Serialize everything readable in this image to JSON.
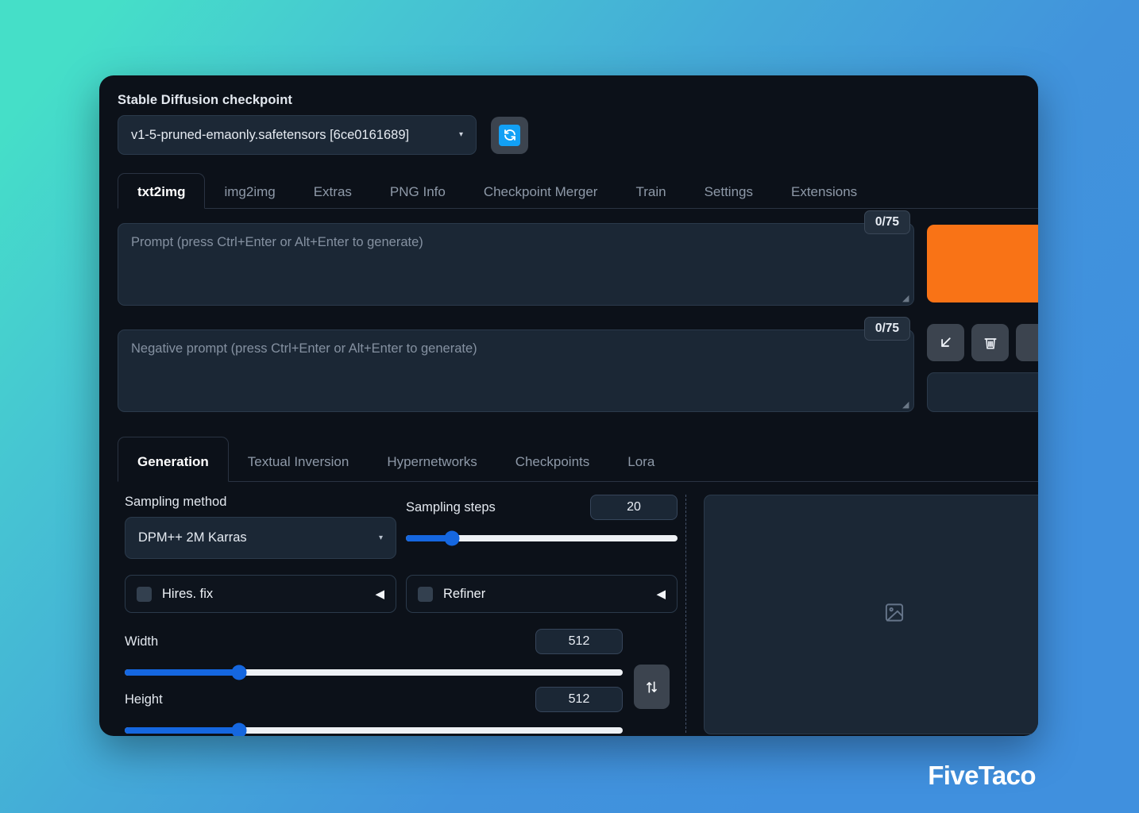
{
  "background": {
    "gradient_from": "#45dfc8",
    "gradient_to": "#4090de"
  },
  "watermark": {
    "text": "FiveTaco"
  },
  "checkpoint": {
    "label": "Stable Diffusion checkpoint",
    "value": "v1-5-pruned-emaonly.safetensors [6ce0161689]",
    "caret": "▾",
    "refresh_icon": "↻"
  },
  "main_tabs": [
    {
      "label": "txt2img",
      "active": true
    },
    {
      "label": "img2img",
      "active": false
    },
    {
      "label": "Extras",
      "active": false
    },
    {
      "label": "PNG Info",
      "active": false
    },
    {
      "label": "Checkpoint Merger",
      "active": false
    },
    {
      "label": "Train",
      "active": false
    },
    {
      "label": "Settings",
      "active": false
    },
    {
      "label": "Extensions",
      "active": false
    }
  ],
  "prompt": {
    "placeholder": "Prompt (press Ctrl+Enter or Alt+Enter to generate)",
    "value": "",
    "token_count": "0/75"
  },
  "negative_prompt": {
    "placeholder": "Negative prompt (press Ctrl+Enter or Alt+Enter to generate)",
    "value": "",
    "token_count": "0/75"
  },
  "actions": {
    "generate_label": "",
    "generate_color": "#f97316",
    "icons": [
      {
        "name": "arrow-down-left-icon",
        "glyph": "↙"
      },
      {
        "name": "trash-icon",
        "glyph": "🗑"
      }
    ]
  },
  "sub_tabs": [
    {
      "label": "Generation",
      "active": true
    },
    {
      "label": "Textual Inversion",
      "active": false
    },
    {
      "label": "Hypernetworks",
      "active": false
    },
    {
      "label": "Checkpoints",
      "active": false
    },
    {
      "label": "Lora",
      "active": false
    }
  ],
  "generation": {
    "sampling_method": {
      "label": "Sampling method",
      "value": "DPM++ 2M Karras",
      "caret": "▾"
    },
    "sampling_steps": {
      "label": "Sampling steps",
      "value": "20",
      "fill_percent": 17
    },
    "hires_fix": {
      "label": "Hires. fix",
      "checked": false,
      "arrow": "◀"
    },
    "refiner": {
      "label": "Refiner",
      "checked": false,
      "arrow": "◀"
    },
    "width": {
      "label": "Width",
      "value": "512",
      "fill_percent": 23
    },
    "height": {
      "label": "Height",
      "value": "512",
      "fill_percent": 23
    },
    "swap_icon": "⇅"
  },
  "preview": {
    "placeholder_icon": "image-placeholder-icon"
  }
}
